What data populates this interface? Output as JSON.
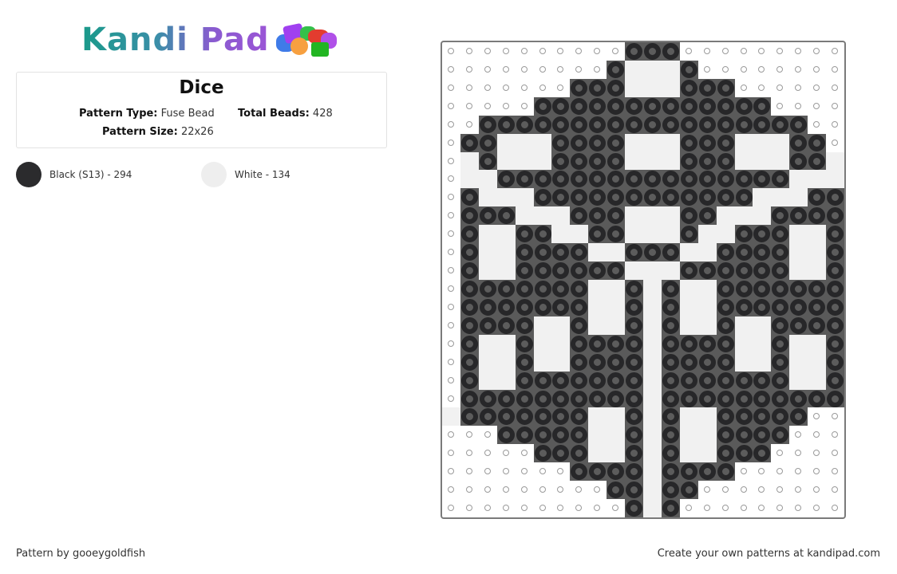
{
  "logo": {
    "text": "Kandi Pad",
    "icon": "beads-cluster-icon"
  },
  "pattern": {
    "title": "Dice",
    "type_label": "Pattern Type:",
    "type_value": "Fuse Bead",
    "beads_label": "Total Beads:",
    "beads_value": "428",
    "size_label": "Pattern Size:",
    "size_value": "22x26"
  },
  "colors": [
    {
      "label": "Black (S13) - 294",
      "hex": "#2b2b2d"
    },
    {
      "label": "White - 134",
      "hex": "#eeeeee"
    }
  ],
  "grid": {
    "columns": 22,
    "rows": 26,
    "legend": {
      ".": "empty",
      "B": "black",
      "W": "white"
    },
    "cells": [
      "..........BBB.........",
      ".........BWWWB........",
      ".......BBBWWWBBB......",
      ".....BBBBBBBBBBBBB....",
      "..BBBBBBBBBBBBBBBBBB..",
      ".BBWWWBBBBWWWBBBWWWBB.",
      ".WBWWWBBBBWWWBBBWWWBBW",
      ".WWBBBBBBBBBBBBBBBBWWW",
      ".BWWWBBBBBBBBBBBBWWWBB",
      ".BBBWWWBBBWWWBBWWWBBBB",
      ".BWWBBWWBBWWWBWWBBBWWB",
      ".BWWBBBBWWBBBWWBBBBWWB",
      ".BWWBBBBBBWWWBBBBBBWWB",
      ".BBBBBBBWWBWBWWBBBBBBB",
      ".BBBBBBBWWBWBWWBBBBBBB",
      ".BBBBWWBWWBWBWWBWWBBBB",
      ".BWWBWWBBBBWBBBBWWBWWB",
      ".BWWBWWBBBBWBBBBWWBWWB",
      ".BWWBBBBBBBWBBBBBBBWWB",
      ".BBBBBBBBBBWBBBBBBBBBB",
      "WBBBBBBBWWBWBWWBBBBB..",
      "...BBBBBWWBWBWWBBBB...",
      ".....BBBWWBWBWWBBB....",
      ".......BBBBWBBBB......",
      ".........BBWBB........",
      "..........BWB........."
    ]
  },
  "footer": {
    "author": "Pattern by gooeygoldfish",
    "promo": "Create your own patterns at kandipad.com"
  }
}
